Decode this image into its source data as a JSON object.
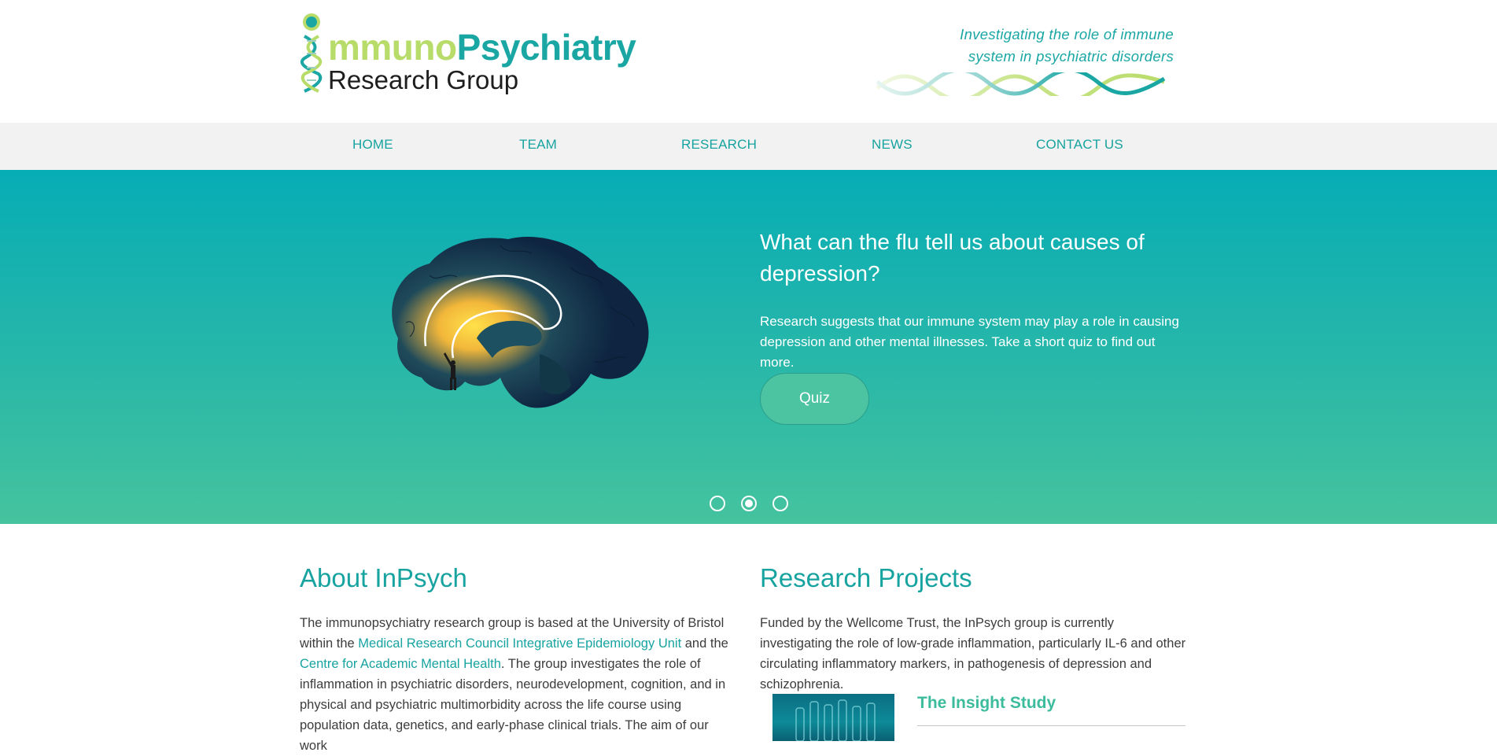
{
  "header": {
    "logo_part1": "mmuno",
    "logo_part2": "Psychiatry",
    "logo_sub": "Research Group",
    "tagline_line1": "Investigating the role of immune",
    "tagline_line2": "system in psychiatric disorders"
  },
  "nav": {
    "items": [
      {
        "label": "HOME"
      },
      {
        "label": "TEAM"
      },
      {
        "label": "RESEARCH"
      },
      {
        "label": "NEWS"
      },
      {
        "label": "CONTACT US"
      }
    ]
  },
  "hero": {
    "heading": "What can the flu tell us about causes of depression?",
    "text": "Research suggests that our immune system may play a role in causing depression and other mental illnesses. Take a short quiz to find out more.",
    "button_label": "Quiz",
    "slides_total": 3,
    "active_slide": 2
  },
  "about": {
    "title": "About InPsych",
    "text_1": "The immunopsychiatry research group is based at the University of Bristol within the ",
    "link_1": "Medical Research Council Integrative Epidemiology Unit",
    "text_2": " and the ",
    "link_2": "Centre for Academic Mental Health",
    "text_3": ".  The group investigates the role of inflammation in psychiatric disorders, neurodevelopment, cognition, and in physical and psychiatric multimorbidity across the life course using population data, genetics, and early-phase clinical trials. The aim of our work"
  },
  "research": {
    "title": "Research Projects",
    "text": "Funded by the Wellcome Trust, the InPsych group is currently investigating the role of low-grade inflammation, particularly IL-6 and other circulating inflammatory markers, in pathogenesis of depression and schizophrenia.",
    "project_title": "The Insight Study"
  },
  "colors": {
    "accent_teal": "#17a3a0",
    "accent_green": "#b8dc6a",
    "hero_top": "#06adb5",
    "hero_bottom": "#45c39e"
  }
}
